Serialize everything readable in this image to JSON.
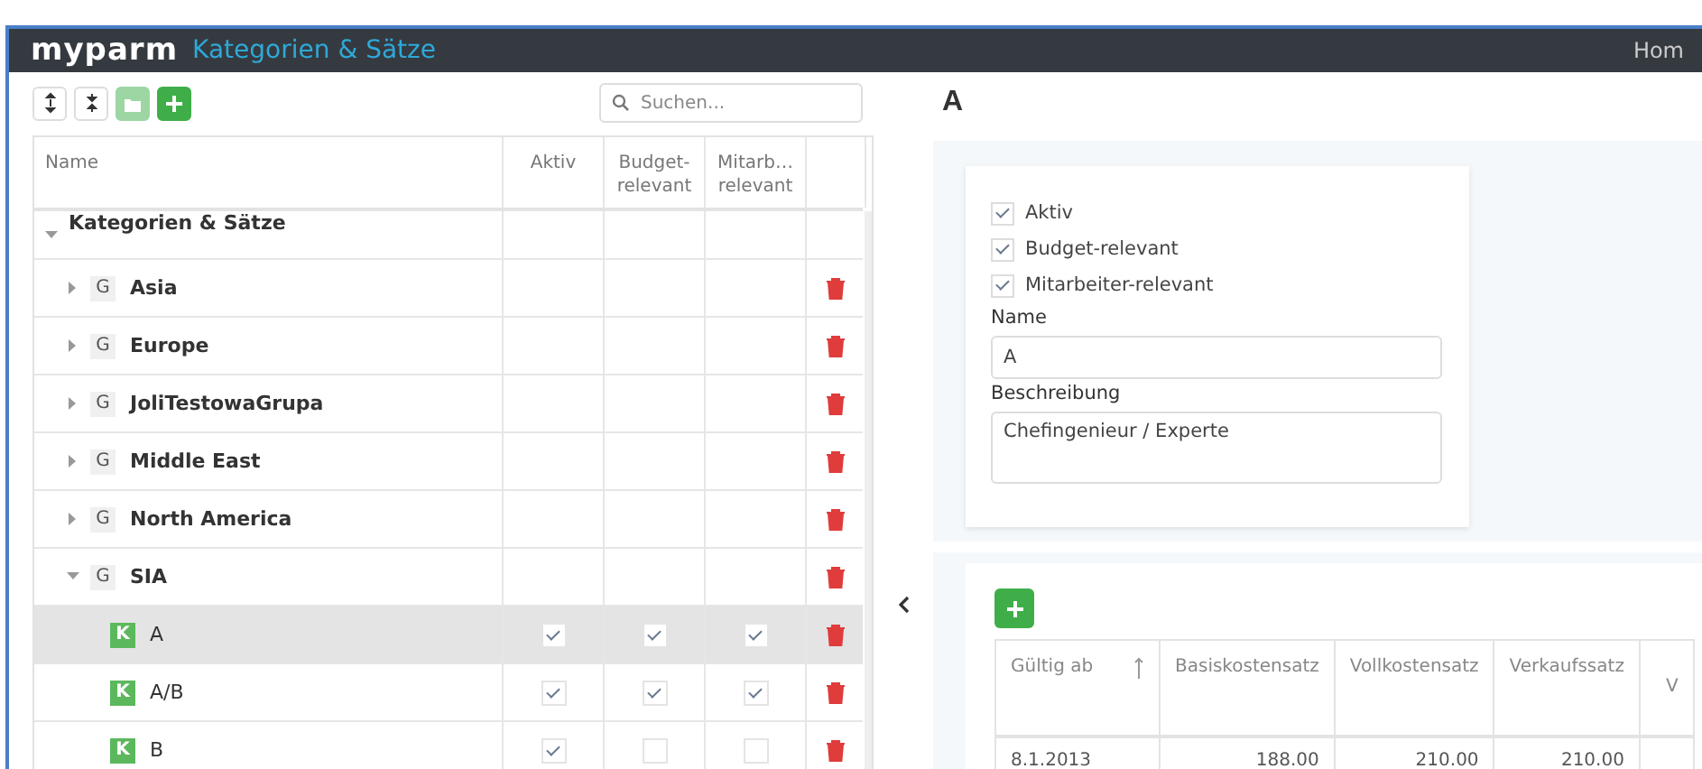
{
  "header": {
    "logo": "myparm",
    "title": "Kategorien & Sätze",
    "nav": "Hom"
  },
  "toolbar": {
    "buttons": [
      {
        "kind": "expand",
        "disabled": false
      },
      {
        "kind": "collapse",
        "disabled": false
      },
      {
        "kind": "folder",
        "disabled": true
      },
      {
        "kind": "add",
        "disabled": false
      }
    ],
    "search": {
      "placeholder": "Suchen..."
    }
  },
  "tree": {
    "columns": [
      "Name",
      "Aktiv",
      "Budget-relevant",
      "Mitarb… relevant"
    ],
    "rows": [
      {
        "kind": "root",
        "name": "Kategorien & Sätze",
        "expanded": true,
        "selected": false,
        "children": [
          {
            "kind": "group",
            "badge": "G",
            "name": "Asia",
            "expanded": false,
            "selected": false
          },
          {
            "kind": "group",
            "badge": "G",
            "name": "Europe",
            "expanded": false,
            "selected": false
          },
          {
            "kind": "group",
            "badge": "G",
            "name": "JoliTestowaGrupa",
            "expanded": false,
            "selected": false
          },
          {
            "kind": "group",
            "badge": "G",
            "name": "Middle East",
            "expanded": false,
            "selected": false
          },
          {
            "kind": "group",
            "badge": "G",
            "name": "North America",
            "expanded": false,
            "selected": false
          },
          {
            "kind": "group",
            "badge": "G",
            "name": "SIA",
            "expanded": true,
            "selected": false,
            "children": [
              {
                "kind": "category",
                "badge": "K",
                "name": "A",
                "selected": true,
                "aktiv": true,
                "budget": true,
                "mitarbeiter": true
              },
              {
                "kind": "category",
                "badge": "K",
                "name": "A/B",
                "selected": false,
                "aktiv": true,
                "budget": true,
                "mitarbeiter": true
              },
              {
                "kind": "category",
                "badge": "K",
                "name": "B",
                "selected": false,
                "aktiv": true,
                "budget": false,
                "mitarbeiter": false
              }
            ]
          }
        ]
      }
    ]
  },
  "detail": {
    "heading": "A",
    "checkboxes": [
      {
        "label": "Aktiv",
        "checked": true
      },
      {
        "label": "Budget-relevant",
        "checked": true
      },
      {
        "label": "Mitarbeiter-relevant",
        "checked": true
      }
    ],
    "fields": [
      {
        "kind": "input",
        "label": "Name",
        "value": "A"
      },
      {
        "kind": "textarea",
        "label": "Beschreibung",
        "value": "Chefingenieur / Experte"
      }
    ],
    "rates": {
      "columns": [
        {
          "label": "Gültig ab",
          "sorted": true
        },
        {
          "label": "Basiskostensatz",
          "sorted": false
        },
        {
          "label": "Vollkostensatz",
          "sorted": false
        },
        {
          "label": "Verkaufssatz",
          "sorted": false
        },
        {
          "label": "V",
          "sorted": false
        }
      ],
      "rows": [
        [
          "8.1.2013",
          "188.00",
          "210.00",
          "210.00"
        ]
      ]
    }
  }
}
